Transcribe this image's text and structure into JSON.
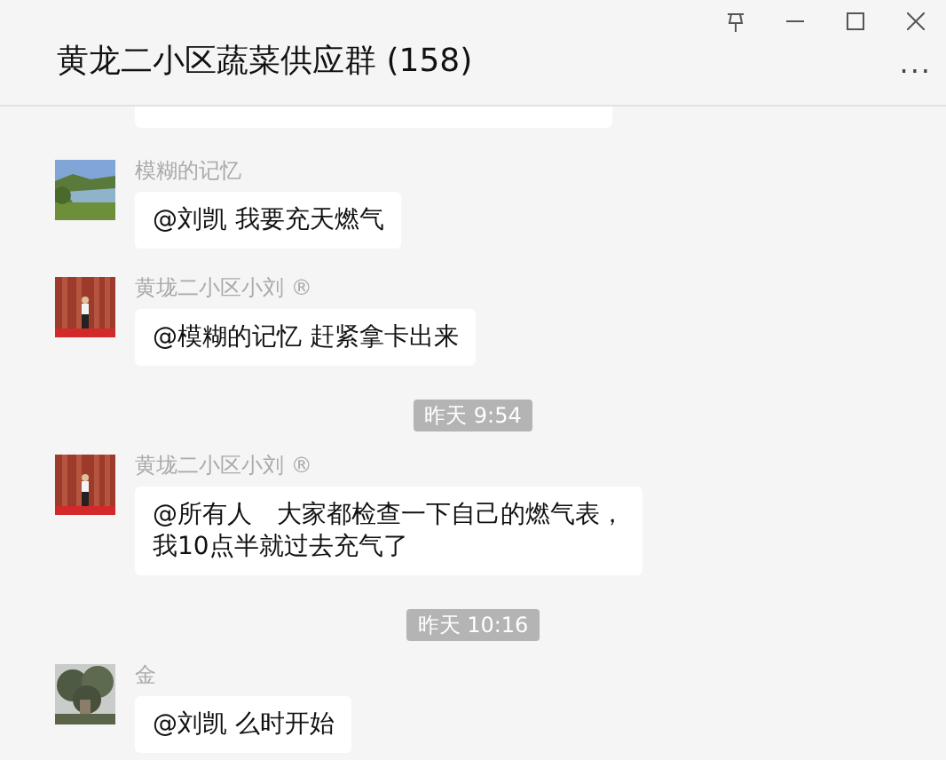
{
  "window": {
    "title": "黄龙二小区蔬菜供应群 (158)",
    "more": "..."
  },
  "items": [
    {
      "kind": "clipped"
    },
    {
      "kind": "message",
      "sender": "模糊的记忆",
      "lines": [
        "@刘凯 我要充天燃气"
      ]
    },
    {
      "kind": "message",
      "sender": "黄垅二小区小刘 ®",
      "lines": [
        "@模糊的记忆 赶紧拿卡出来"
      ]
    },
    {
      "kind": "time",
      "text": "昨天 9:54"
    },
    {
      "kind": "message",
      "sender": "黄垅二小区小刘 ®",
      "lines": [
        "@所有人　大家都检查一下自己的燃气表，",
        "我10点半就过去充气了"
      ]
    },
    {
      "kind": "time",
      "text": "昨天 10:16"
    },
    {
      "kind": "message",
      "sender": "金",
      "lines": [
        "@刘凯 么时开始"
      ]
    }
  ]
}
